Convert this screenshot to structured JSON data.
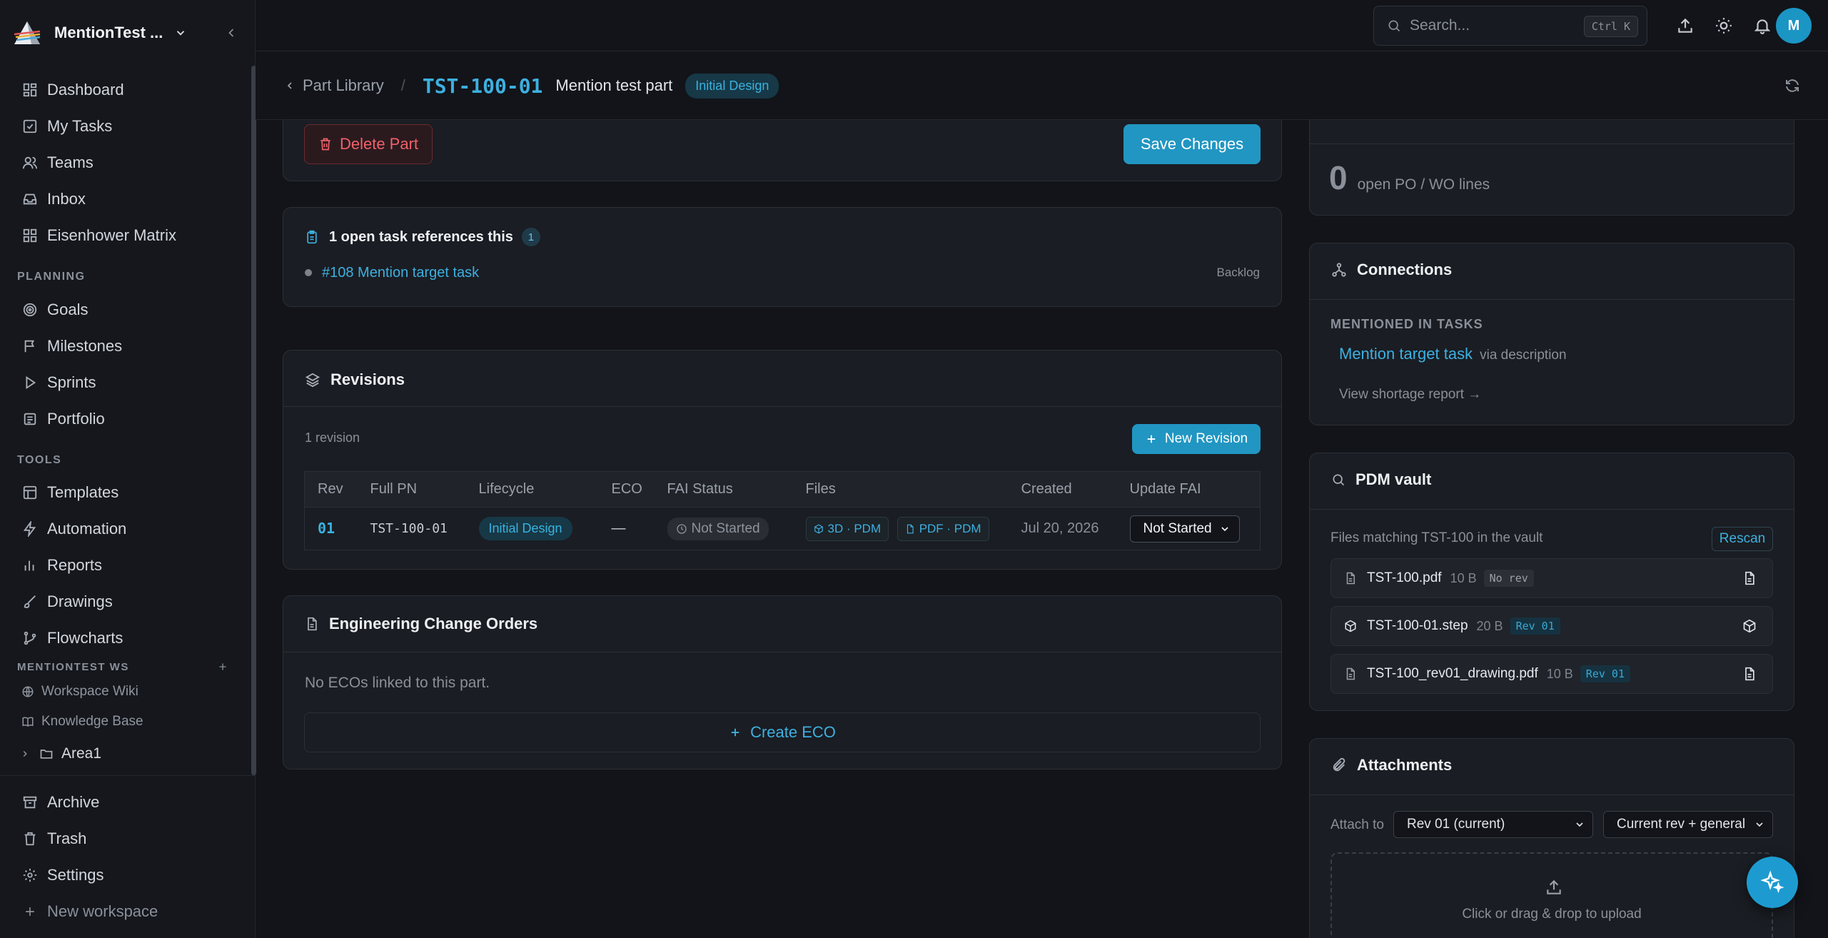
{
  "workspace": {
    "name": "MentionTest ..."
  },
  "nav": {
    "main": [
      {
        "label": "Dashboard",
        "icon": "dashboard-icon"
      },
      {
        "label": "My Tasks",
        "icon": "checkbox-icon"
      },
      {
        "label": "Teams",
        "icon": "users-icon"
      },
      {
        "label": "Inbox",
        "icon": "inbox-icon"
      },
      {
        "label": "Eisenhower Matrix",
        "icon": "grid-icon"
      }
    ],
    "planning_label": "PLANNING",
    "planning": [
      {
        "label": "Goals",
        "icon": "target-icon"
      },
      {
        "label": "Milestones",
        "icon": "flag-icon"
      },
      {
        "label": "Sprints",
        "icon": "play-icon"
      },
      {
        "label": "Portfolio",
        "icon": "portfolio-icon"
      }
    ],
    "tools_label": "TOOLS",
    "tools": [
      {
        "label": "Templates",
        "icon": "template-icon"
      },
      {
        "label": "Automation",
        "icon": "bolt-icon"
      },
      {
        "label": "Reports",
        "icon": "bar-chart-icon"
      },
      {
        "label": "Drawings",
        "icon": "brush-icon"
      },
      {
        "label": "Flowcharts",
        "icon": "flowchart-icon"
      }
    ],
    "ws_label": "MENTIONTEST WS",
    "ws_items": [
      {
        "label": "Workspace Wiki",
        "icon": "globe-icon"
      },
      {
        "label": "Knowledge Base",
        "icon": "book-icon"
      }
    ],
    "folder": "Area1",
    "bottom": [
      {
        "label": "Archive",
        "icon": "archive-icon"
      },
      {
        "label": "Trash",
        "icon": "trash-icon"
      },
      {
        "label": "Settings",
        "icon": "gear-icon"
      },
      {
        "label": "New workspace",
        "icon": "plus-icon"
      }
    ]
  },
  "topbar": {
    "search_placeholder": "Search...",
    "shortcut": "Ctrl K",
    "avatar": "M"
  },
  "breadcrumb": {
    "back": "Part Library",
    "separator": "/",
    "part_number": "TST-100-01",
    "part_name": "Mention test part",
    "status": "Initial Design"
  },
  "actions": {
    "delete": "Delete Part",
    "save": "Save Changes"
  },
  "task_refs": {
    "title": "1 open task references this",
    "count": "1",
    "items": [
      {
        "label": "#108 Mention target task",
        "status": "Backlog"
      }
    ]
  },
  "revisions": {
    "title": "Revisions",
    "count_label": "1 revision",
    "new_button": "New Revision",
    "columns": [
      "Rev",
      "Full PN",
      "Lifecycle",
      "ECO",
      "FAI Status",
      "Files",
      "Created",
      "Update FAI"
    ],
    "rows": [
      {
        "rev": "01",
        "full_pn": "TST-100-01",
        "lifecycle": "Initial Design",
        "eco": "—",
        "fai_status": "Not Started",
        "files": [
          "3D · PDM",
          "PDF · PDM"
        ],
        "created": "Jul 20, 2026",
        "update_fai": "Not Started"
      }
    ]
  },
  "ecos": {
    "title": "Engineering Change Orders",
    "empty": "No ECOs linked to this part.",
    "create": "Create ECO"
  },
  "open_lines": {
    "count": "0",
    "label": "open PO / WO lines"
  },
  "connections": {
    "title": "Connections",
    "subtitle": "MENTIONED IN TASKS",
    "link": "Mention target task",
    "via": "via description",
    "report_link": "View shortage report →"
  },
  "pdm": {
    "title": "PDM vault",
    "subtitle": "Files matching TST-100 in the vault",
    "rescan": "Rescan",
    "files": [
      {
        "name": "TST-100.pdf",
        "size": "10 B",
        "rev": "No rev",
        "icon": "file-icon"
      },
      {
        "name": "TST-100-01.step",
        "size": "20 B",
        "rev": "Rev 01",
        "icon": "cube-icon"
      },
      {
        "name": "TST-100_rev01_drawing.pdf",
        "size": "10 B",
        "rev": "Rev 01",
        "icon": "file-icon"
      }
    ]
  },
  "attachments": {
    "title": "Attachments",
    "attach_to_label": "Attach to",
    "attach_to_value": "Rev 01 (current)",
    "scope_value": "Current rev + general",
    "upload_text": "Click or drag & drop to upload"
  },
  "colors": {
    "accent": "#2196c2",
    "link": "#3db0e0",
    "danger": "#f0616a",
    "bg": "#121419",
    "card": "#1a1d23"
  }
}
